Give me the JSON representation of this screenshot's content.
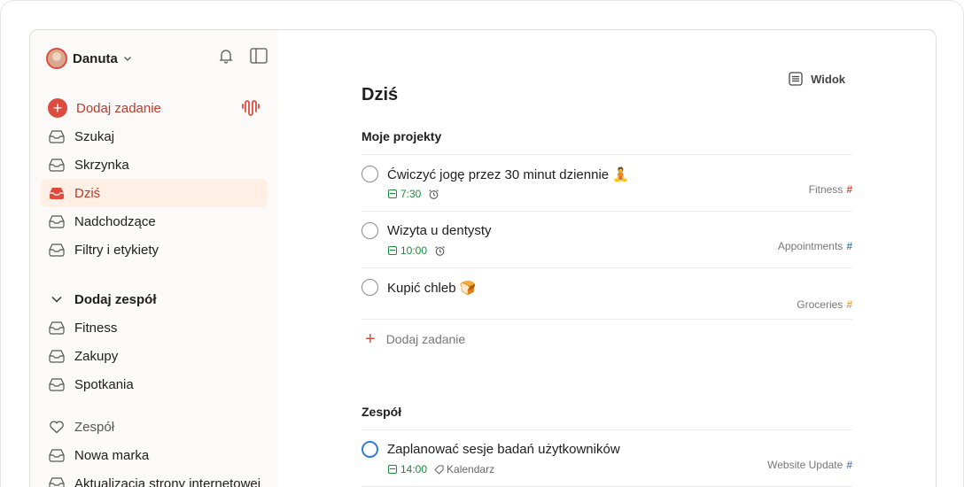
{
  "user": {
    "name": "Danuta"
  },
  "sidebar": {
    "add_task": "Dodaj zadanie",
    "items": [
      {
        "label": "Szukaj",
        "icon": "search-icon"
      },
      {
        "label": "Skrzynka",
        "icon": "inbox-icon"
      },
      {
        "label": "Dziś",
        "icon": "today-icon",
        "active": true
      },
      {
        "label": "Nadchodzące",
        "icon": "upcoming-icon"
      },
      {
        "label": "Filtry i etykiety",
        "icon": "filters-icon"
      }
    ],
    "team_section": "Dodaj zespół",
    "team_projects": [
      "Fitness",
      "Zakupy",
      "Spotkania"
    ],
    "team_label": "Zespół",
    "team2_projects": [
      "Nowa marka",
      "Aktualizacja strony internetowej"
    ]
  },
  "main": {
    "view_label": "Widok",
    "title": "Dziś",
    "groups": [
      {
        "title": "Moje projekty",
        "tasks": [
          {
            "name": "Ćwiczyć jogę przez 30 minut dziennie",
            "emoji": "🧘",
            "time": "7:30",
            "alarm": true,
            "project": "Fitness",
            "project_color": "#dc4c3e"
          },
          {
            "name": "Wizyta u dentysty",
            "time": "10:00",
            "alarm": true,
            "project": "Appointments",
            "project_color": "#4a7fc1"
          },
          {
            "name": "Kupić chleb",
            "emoji": "🍞",
            "project": "Groceries",
            "project_color": "#e8a23a"
          }
        ],
        "add_task": "Dodaj zadanie"
      },
      {
        "title": "Zespół",
        "tasks": [
          {
            "name": "Zaplanować sesje badań użytkowników",
            "time": "14:00",
            "label": "Kalendarz",
            "project": "Website Update",
            "project_color": "#6b7fc7"
          }
        ]
      }
    ]
  },
  "colors": {
    "accent": "#dc4c3e",
    "active_bg": "#ffefe5",
    "sidebar_bg": "#fcfaf8",
    "time_green": "#1a8a3b"
  }
}
